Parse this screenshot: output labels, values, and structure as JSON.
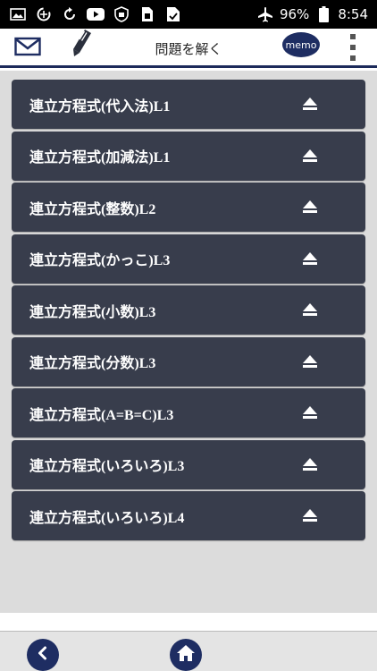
{
  "status_bar": {
    "battery_percent": "96%",
    "time": "8:54",
    "icons": [
      "image-icon",
      "data-saver-icon",
      "sync-icon",
      "youtube-icon",
      "shield-icon",
      "sim-icon",
      "file-check-icon"
    ]
  },
  "header": {
    "title": "問題を解く",
    "memo_label": "memo",
    "accent_color": "#1e2d62"
  },
  "items": [
    {
      "label": "連立方程式(代入法)L1"
    },
    {
      "label": "連立方程式(加減法)L1"
    },
    {
      "label": "連立方程式(整数)L2"
    },
    {
      "label": "連立方程式(かっこ)L3"
    },
    {
      "label": "連立方程式(小数)L3"
    },
    {
      "label": "連立方程式(分数)L3"
    },
    {
      "label": "連立方程式(A=B=C)L3"
    },
    {
      "label": "連立方程式(いろいろ)L3"
    },
    {
      "label": "連立方程式(いろいろ)L4"
    }
  ],
  "bottom_nav": {
    "icons": [
      "back-icon",
      "home-icon"
    ]
  }
}
